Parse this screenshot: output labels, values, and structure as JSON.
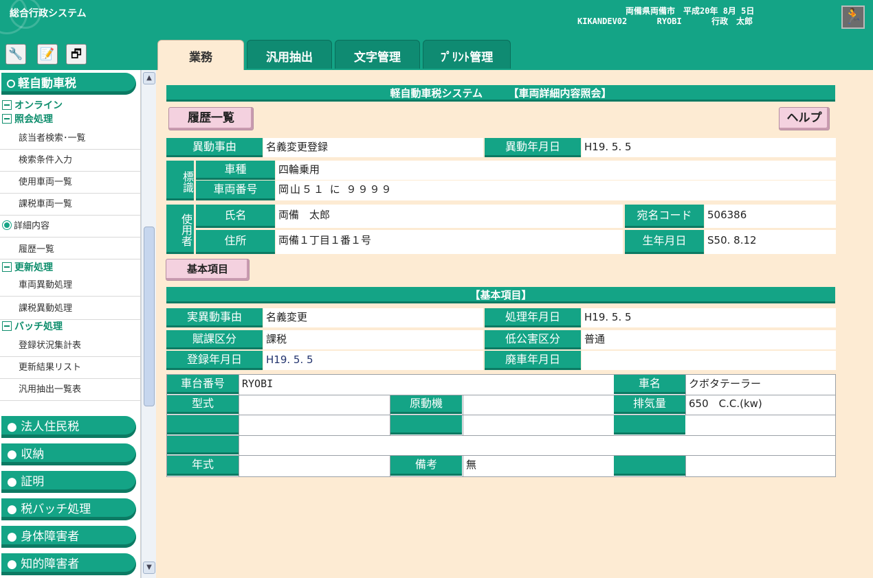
{
  "header": {
    "app_title": "総合行政システム",
    "municipality": "両備県両備市",
    "date": "平成20年 8月 5日",
    "terminal": "KIKANDEV02",
    "user_id": "RYOBI",
    "user_name": "行政　太郎"
  },
  "tabs": [
    "業務",
    "汎用抽出",
    "文字管理",
    "ﾌﾟﾘﾝﾄ管理"
  ],
  "sidebar": {
    "active_system": "軽自動車税",
    "groups": {
      "online": "オンライン",
      "inquiry": "照会処理",
      "update": "更新処理",
      "batch": "バッチ処理"
    },
    "inquiry_items": [
      "該当者検索･一覧",
      "検索条件入力",
      "使用車両一覧",
      "課税車両一覧",
      "詳細内容",
      "履歴一覧"
    ],
    "update_items": [
      "車両異動処理",
      "課税異動処理"
    ],
    "batch_items": [
      "登録状況集計表",
      "更新結果リスト",
      "汎用抽出一覧表"
    ],
    "other_systems": [
      "法人住民税",
      "収納",
      "証明",
      "税バッチ処理",
      "身体障害者",
      "知的障害者"
    ]
  },
  "main": {
    "title": "軽自動車税システム　　　【車両詳細内容照会】",
    "history_button": "履歴一覧",
    "help_button": "ヘルプ",
    "idou_jiyu_label": "異動事由",
    "idou_jiyu": "名義変更登録",
    "idou_date_label": "異動年月日",
    "idou_date": "H19. 5. 5",
    "hyoshiki_label": "標識",
    "shashu_label": "車種",
    "shashu": "四輪乗用",
    "sharyo_bango_label": "車両番号",
    "sharyo_bango": "岡山５１ に ９９９９",
    "shiyosha_label": "使用者",
    "shimei_label": "氏名",
    "shimei": "両備　太郎",
    "atena_code_label": "宛名コード",
    "atena_code": "506386",
    "jusho_label": "住所",
    "jusho": "両備１丁目１番１号",
    "seinengappi_label": "生年月日",
    "seinengappi": "S50. 8.12",
    "basic_tab": "基本項目",
    "basic_title": "【基本項目】",
    "jitsu_idou_jiyu_label": "実異動事由",
    "jitsu_idou_jiyu": "名義変更",
    "shori_date_label": "処理年月日",
    "shori_date": "H19. 5. 5",
    "fuka_kubun_label": "賦課区分",
    "fuka_kubun": "課税",
    "teikougai_label": "低公害区分",
    "teikougai": "普通",
    "toroku_date_label": "登録年月日",
    "toroku_date": "H19. 5. 5",
    "haisha_date_label": "廃車年月日",
    "haisha_date": "",
    "shadai_bango_label": "車台番号",
    "shadai_bango": "RYOBI",
    "shamei_label": "車名",
    "shamei": "クボタテーラー",
    "katashiki_label": "型式",
    "katashiki": "",
    "gendoki_label": "原動機",
    "gendoki": "",
    "haikiryo_label": "排気量",
    "haikiryo": "650　C.C.(kw)",
    "nenshiki_label": "年式",
    "nenshiki": "",
    "biko_label": "備考",
    "biko": "無"
  }
}
